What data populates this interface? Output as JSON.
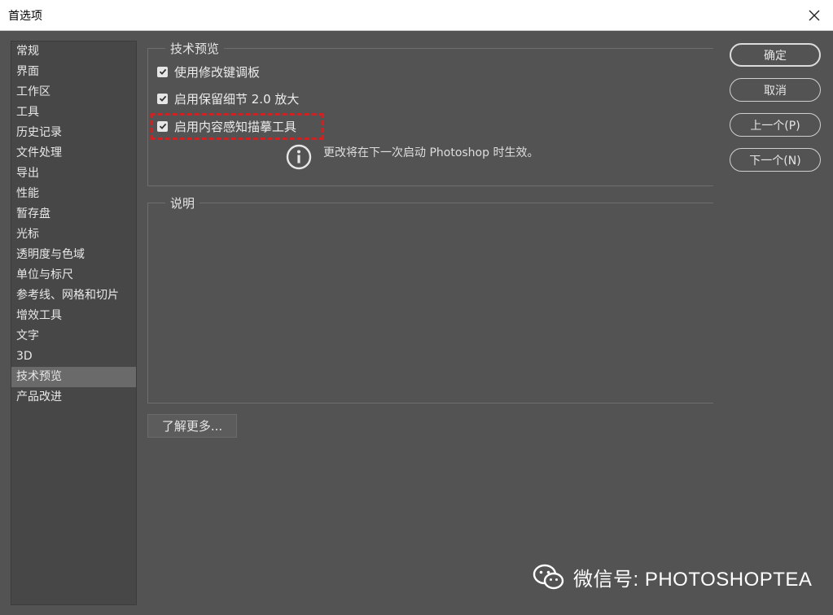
{
  "window": {
    "title": "首选项"
  },
  "sidebar": {
    "items": [
      {
        "label": "常规"
      },
      {
        "label": "界面"
      },
      {
        "label": "工作区"
      },
      {
        "label": "工具"
      },
      {
        "label": "历史记录"
      },
      {
        "label": "文件处理"
      },
      {
        "label": "导出"
      },
      {
        "label": "性能"
      },
      {
        "label": "暂存盘"
      },
      {
        "label": "光标"
      },
      {
        "label": "透明度与色域"
      },
      {
        "label": "单位与标尺"
      },
      {
        "label": "参考线、网格和切片"
      },
      {
        "label": "增效工具"
      },
      {
        "label": "文字"
      },
      {
        "label": "3D"
      },
      {
        "label": "技术预览",
        "selected": true
      },
      {
        "label": "产品改进"
      }
    ]
  },
  "tech_preview": {
    "legend": "技术预览",
    "options": [
      {
        "label": "使用修改键调板",
        "checked": true
      },
      {
        "label": "启用保留细节 2.0 放大",
        "checked": true
      },
      {
        "label": "启用内容感知描摹工具",
        "checked": true
      }
    ],
    "info_text": "更改将在下一次启动 Photoshop 时生效。"
  },
  "description": {
    "legend": "说明"
  },
  "learn_more": {
    "label": "了解更多..."
  },
  "buttons": {
    "ok": "确定",
    "cancel": "取消",
    "prev": "上一个(P)",
    "next": "下一个(N)"
  },
  "watermark": {
    "text": "微信号: PHOTOSHOPTEA"
  },
  "colors": {
    "background": "#535353",
    "sidebar": "#474747",
    "selected": "#6a6a6a",
    "highlight": "#d42020"
  }
}
